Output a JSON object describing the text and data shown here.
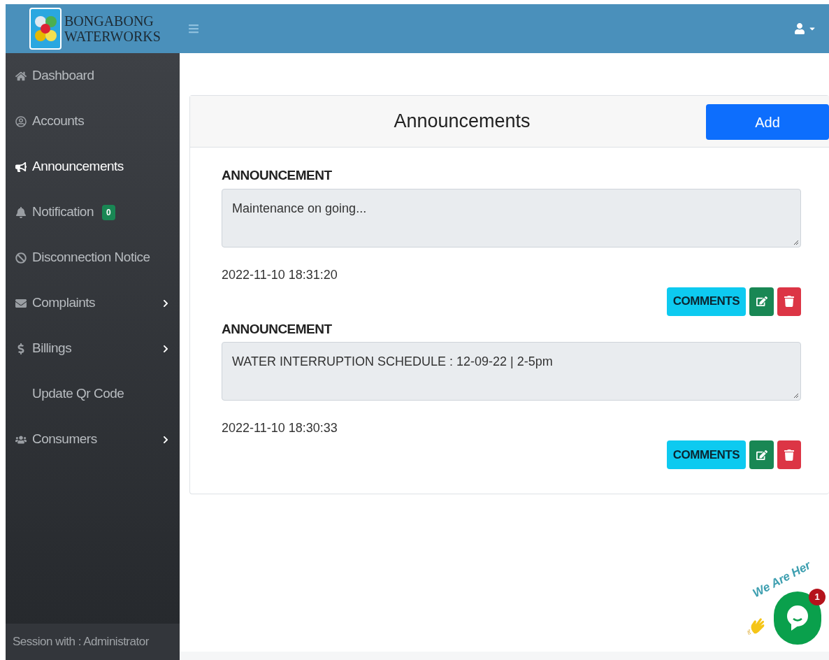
{
  "header": {
    "logo_line_1": "BONGABONG",
    "logo_line_2": "WATERWORKS"
  },
  "sidebar": {
    "items": [
      {
        "label": "Dashboard",
        "selected": false,
        "submenu": false
      },
      {
        "label": "Accounts",
        "selected": false,
        "submenu": false
      },
      {
        "label": "Announcements",
        "selected": true,
        "submenu": false
      },
      {
        "label": "Notification",
        "selected": false,
        "submenu": false,
        "badge": "0"
      },
      {
        "label": "Disconnection Notice",
        "selected": false,
        "submenu": false
      },
      {
        "label": "Complaints",
        "selected": false,
        "submenu": true
      },
      {
        "label": "Billings",
        "selected": false,
        "submenu": true
      },
      {
        "label": "Update Qr Code",
        "selected": false,
        "submenu": false
      },
      {
        "label": "Consumers",
        "selected": false,
        "submenu": true
      }
    ],
    "footer": "Session with : Administrator"
  },
  "panel": {
    "title": "Announcements",
    "add_button": "Add",
    "announcements": [
      {
        "heading": "ANNOUNCEMENT",
        "text": "Maintenance on going...",
        "date": "2022-11-10 18:31:20",
        "comments_button": "COMMENTS"
      },
      {
        "heading": "ANNOUNCEMENT",
        "text": "WATER INTERRUPTION SCHEDULE : 12-09-22 | 2-5pm",
        "date": "2022-11-10 18:30:33",
        "comments_button": "COMMENTS"
      }
    ]
  },
  "chat_widget": {
    "caption": "We Are Her",
    "count": "1"
  }
}
